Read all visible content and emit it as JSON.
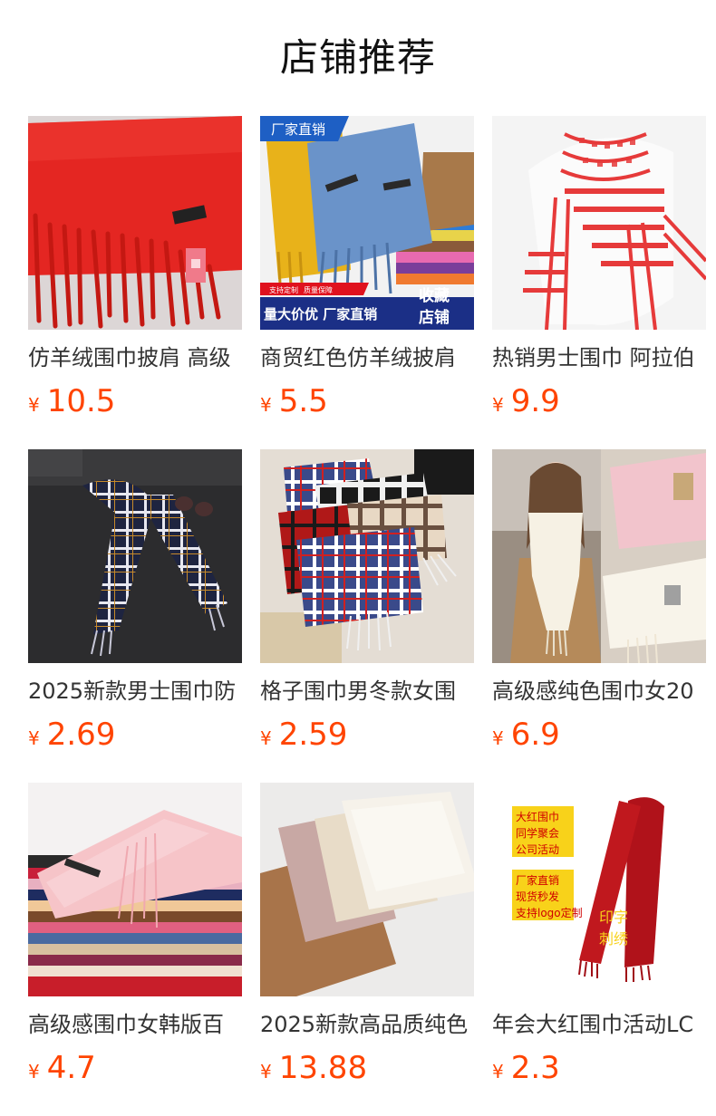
{
  "page": {
    "title": "店铺推荐"
  },
  "products": [
    {
      "name": "仿羊绒围巾披肩 高级",
      "currency": "¥",
      "price": "10.5",
      "image": "red-tassel-scarf",
      "badges": []
    },
    {
      "name": "商贸红色仿羊绒披肩",
      "currency": "¥",
      "price": "5.5",
      "image": "multicolor-scarves",
      "badges": [
        "厂家直销",
        "支持定制",
        "质量保障",
        "量大价优 厂家直销",
        "收藏",
        "店铺"
      ]
    },
    {
      "name": "热销男士围巾 阿拉伯",
      "currency": "¥",
      "price": "9.9",
      "image": "red-white-keffiyeh",
      "badges": []
    },
    {
      "name": "2025新款男士围巾防",
      "currency": "¥",
      "price": "2.69",
      "image": "navy-plaid-scarf",
      "badges": []
    },
    {
      "name": "格子围巾男冬款女围",
      "currency": "¥",
      "price": "2.59",
      "image": "plaid-scarf-set",
      "badges": []
    },
    {
      "name": "高级感纯色围巾女20",
      "currency": "¥",
      "price": "6.9",
      "image": "cream-scarf-model",
      "badges": []
    },
    {
      "name": "高级感围巾女韩版百",
      "currency": "¥",
      "price": "4.7",
      "image": "pink-scarf-stack",
      "badges": []
    },
    {
      "name": "2025新款高品质纯色",
      "currency": "¥",
      "price": "13.88",
      "image": "neutral-folded-scarves",
      "badges": []
    },
    {
      "name": "年会大红围巾活动LC",
      "currency": "¥",
      "price": "2.3",
      "image": "big-red-event-scarf",
      "badges": [
        "大红围巾",
        "同学聚会",
        "公司活动",
        "厂家直销",
        "现货秒发",
        "支持logo定制",
        "印字",
        "刺绣"
      ]
    }
  ],
  "colors": {
    "price": "#ff4400",
    "title": "#111111",
    "text": "#333333"
  }
}
